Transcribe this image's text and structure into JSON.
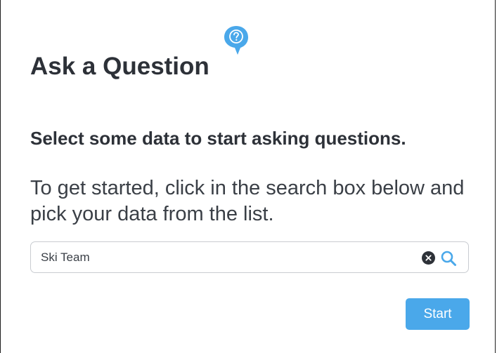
{
  "header": {
    "title": "Ask a Question",
    "help_icon": "question-bubble-icon"
  },
  "main": {
    "subtitle": "Select some data to start asking questions.",
    "instructions": "To get started, click in the search box below and pick your data from the list."
  },
  "search": {
    "value": "Ski Team",
    "clear_icon": "clear-icon",
    "search_icon": "search-icon"
  },
  "actions": {
    "start_label": "Start"
  },
  "colors": {
    "accent": "#4aa8ea",
    "text": "#2d3138",
    "border": "#c9ccd1"
  }
}
